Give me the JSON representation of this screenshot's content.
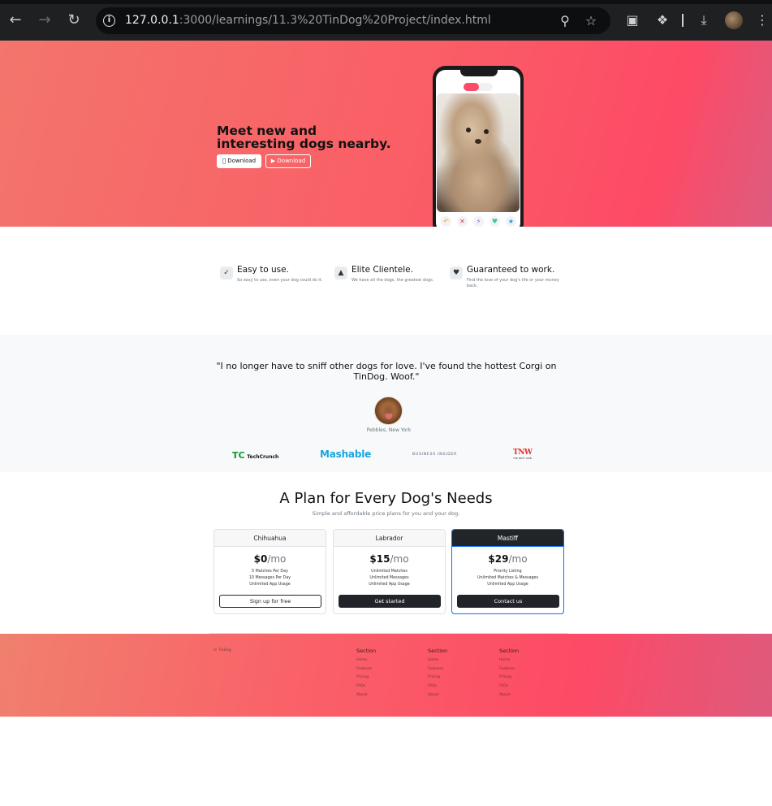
{
  "browser": {
    "url_host": "127.0.0.1",
    "url_rest": ":3000/learnings/11.3%20TinDog%20Project/index.html"
  },
  "hero": {
    "title": "Meet new and interesting dogs nearby.",
    "download_apple": " Download",
    "download_play": "▶ Download",
    "apple_label": "Download",
    "play_label": "Download"
  },
  "features": [
    {
      "icon": "check-circle-icon",
      "title": "Easy to use.",
      "text": "So easy to use, even your dog could do it."
    },
    {
      "icon": "graduation-cap-icon",
      "title": "Elite Clientele.",
      "text": "We have all the dogs, the greatest dogs."
    },
    {
      "icon": "heart-arrow-icon",
      "title": "Guaranteed to work.",
      "text": "Find the love of your dog's life or your money back."
    }
  ],
  "testimonial": {
    "quote": "\"I no longer have to sniff other dogs for love. I've found the hottest Corgi on TinDog. Woof.\"",
    "cite": "Pebbles, New York"
  },
  "press": {
    "techcrunch": "TechCrunch",
    "mashable": "Mashable",
    "business_insider": "BUSINESS INSIDER",
    "tnw": "TNW"
  },
  "pricing": {
    "title": "A Plan for Every Dog's Needs",
    "subtitle": "Simple and affordable price plans for you and your dog.",
    "plans": [
      {
        "name": "Chihuahua",
        "price": "$0",
        "per": "/mo",
        "features": [
          "5 Matches Per Day",
          "10 Messages Per Day",
          "Unlimited App Usage"
        ],
        "cta": "Sign up for free"
      },
      {
        "name": "Labrador",
        "price": "$15",
        "per": "/mo",
        "features": [
          "Unlimited Matches",
          "Unlimited Messages",
          "Unlimited App Usage"
        ],
        "cta": "Get started"
      },
      {
        "name": "Mastiff",
        "price": "$29",
        "per": "/mo",
        "features": [
          "Priority Listing",
          "Unlimited Matches & Messages",
          "Unlimited App Usage"
        ],
        "cta": "Contact us"
      }
    ]
  },
  "footer": {
    "copyright": "© TinDog",
    "columns": [
      {
        "heading": "Section",
        "links": [
          "Home",
          "Features",
          "Pricing",
          "FAQs",
          "About"
        ]
      },
      {
        "heading": "Section",
        "links": [
          "Home",
          "Features",
          "Pricing",
          "FAQs",
          "About"
        ]
      },
      {
        "heading": "Section",
        "links": [
          "Home",
          "Features",
          "Pricing",
          "FAQs",
          "About"
        ]
      }
    ]
  },
  "colors": {
    "brand": "#fd4a66",
    "dark": "#212529",
    "primary_border": "#0d6efd"
  }
}
